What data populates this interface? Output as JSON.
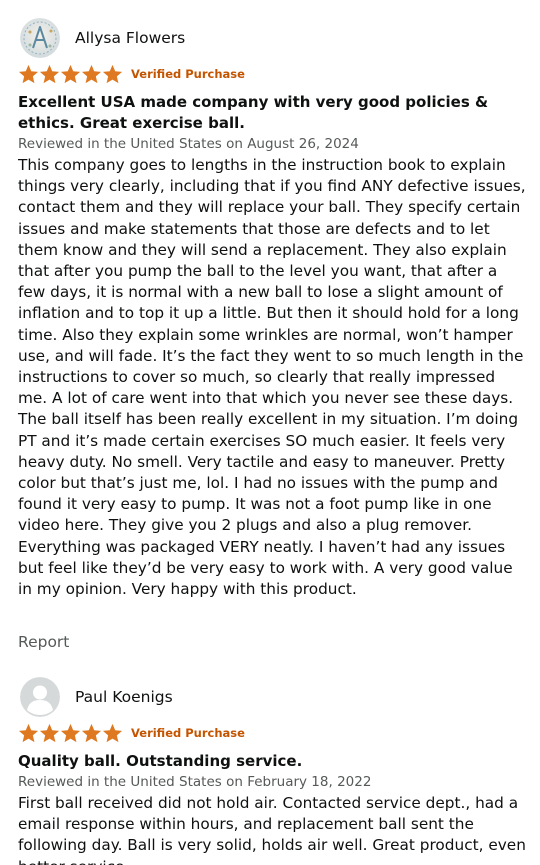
{
  "reviews": [
    {
      "author": "Allysa Flowers",
      "avatar": "custom-avatar",
      "rating": 5,
      "verified_label": "Verified Purchase",
      "title": "Excellent USA made company with very good policies & ethics. Great exercise ball.",
      "date": "Reviewed in the United States on August 26, 2024",
      "body": "This company goes to lengths in the instruction book to explain things very clearly, including that if you find ANY defective issues, contact them and they will replace your ball. They specify certain issues and make statements that those are defects and to let them know and they will send a replacement. They also explain that after you pump the ball to the level you want, that after a few days, it is normal with a new ball to lose a slight amount of inflation and to top it up a little. But then it should hold for a long time. Also they explain some wrinkles are normal, won’t hamper use, and will fade. It’s the fact they went to so much length in the instructions to cover so much, so clearly that really impressed me. A lot of care went into that which you never see these days. The ball itself has been really excellent in my situation. I’m doing PT and it’s made certain exercises SO much easier. It feels very heavy duty. No smell. Very tactile and easy to maneuver. Pretty color but that’s just me, lol. I had no issues with the pump and found it very easy to pump. It was not a foot pump like in one video here. They give you 2 plugs and also a plug remover. Everything was packaged VERY neatly. I haven’t had any issues but feel like they’d be very easy to work with. A very good value in my opinion. Very happy with this product.",
      "report_label": "Report"
    },
    {
      "author": "Paul Koenigs",
      "avatar": "default-avatar",
      "rating": 5,
      "verified_label": "Verified Purchase",
      "title": "Quality ball. Outstanding service.",
      "date": "Reviewed in the United States on February 18, 2022",
      "body": "First ball received did not hold air. Contacted service dept., had a email response within hours, and replacement ball sent the following day. Ball is very solid, holds air well. Great product, even better service."
    }
  ],
  "colors": {
    "star": "#de7921",
    "verified": "#c45500",
    "secondary_text": "#565959",
    "primary_text": "#0f1111"
  }
}
